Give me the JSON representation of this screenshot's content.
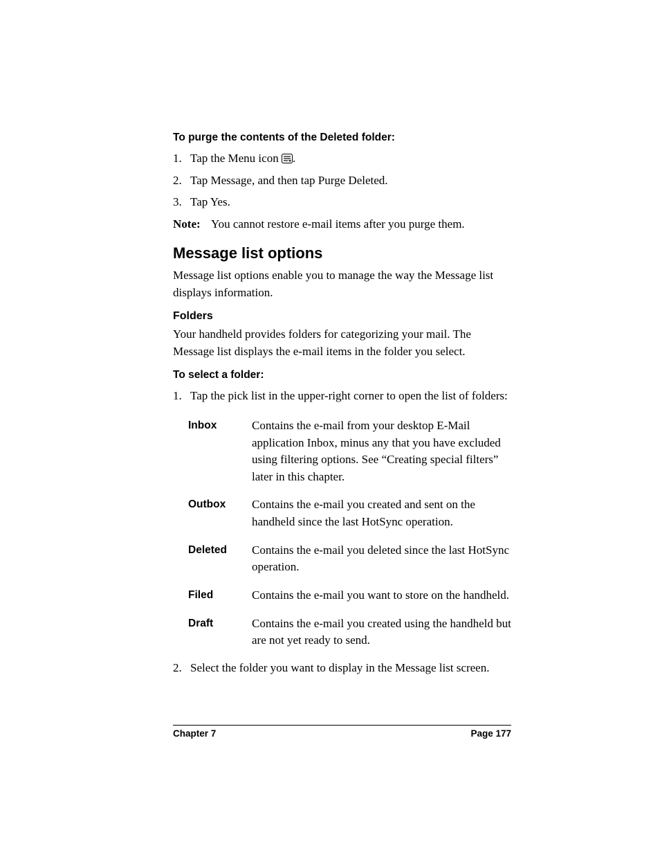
{
  "proc_purge": {
    "heading": "To purge the contents of the Deleted folder:",
    "steps": [
      {
        "num": "1.",
        "pre": "Tap the Menu icon ",
        "post": "."
      },
      {
        "num": "2.",
        "text": "Tap Message, and then tap Purge Deleted."
      },
      {
        "num": "3.",
        "text": "Tap Yes."
      }
    ],
    "note_label": "Note:",
    "note_text": "You cannot restore e-mail items after you purge them."
  },
  "section": {
    "title": "Message list options",
    "intro": "Message list options enable you to manage the way the Message list displays information."
  },
  "folders": {
    "heading": "Folders",
    "intro": "Your handheld provides folders for categorizing your mail. The Message list displays the e-mail items in the folder you select.",
    "proc_heading": "To select a folder:",
    "step1": {
      "num": "1.",
      "text": "Tap the pick list in the upper-right corner to open the list of folders:"
    },
    "items": [
      {
        "term": "Inbox",
        "desc": "Contains the e-mail from your desktop E-Mail application Inbox, minus any that you have excluded using filtering options. See “Creating special filters” later in this chapter."
      },
      {
        "term": "Outbox",
        "desc": "Contains the e-mail you created and sent on the handheld since the last HotSync operation."
      },
      {
        "term": "Deleted",
        "desc": "Contains the e-mail you deleted since the last HotSync operation."
      },
      {
        "term": "Filed",
        "desc": "Contains the e-mail you want to store on the handheld."
      },
      {
        "term": "Draft",
        "desc": "Contains the e-mail you created using the handheld but are not yet ready to send."
      }
    ],
    "step2": {
      "num": "2.",
      "text": "Select the folder you want to display in the Message list screen."
    }
  },
  "footer": {
    "left": "Chapter 7",
    "right": "Page 177"
  }
}
